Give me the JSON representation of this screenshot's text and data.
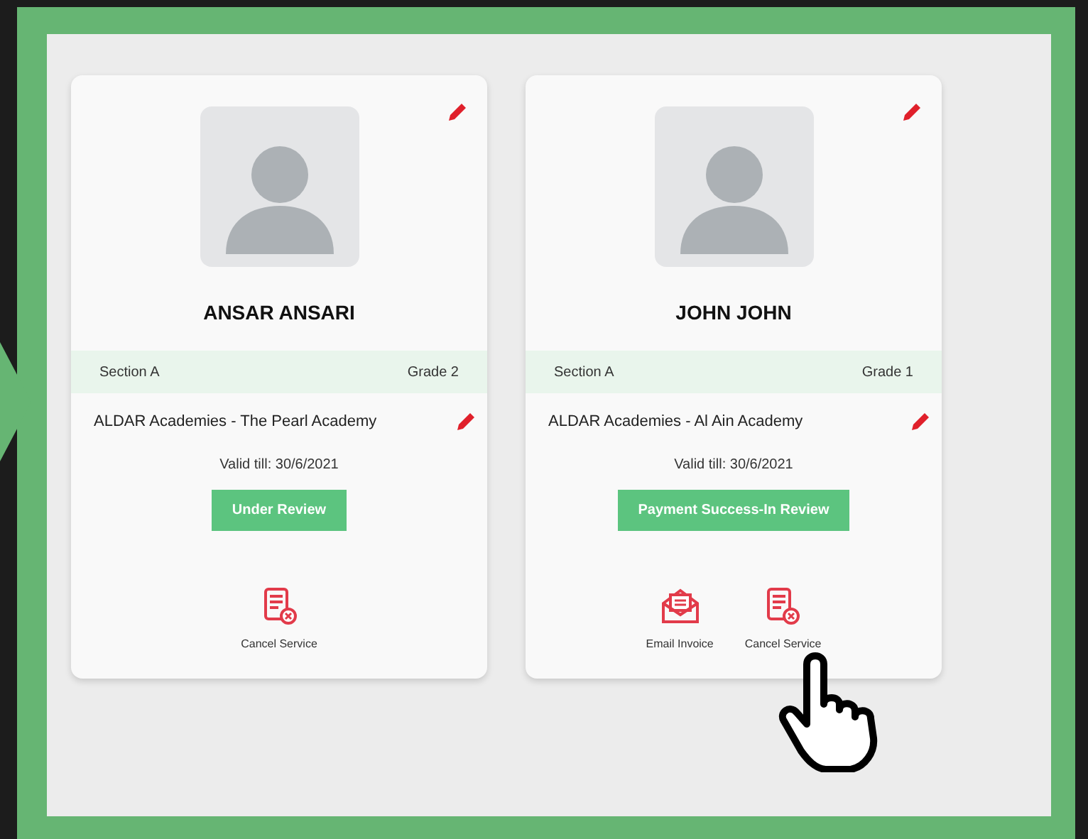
{
  "cards": [
    {
      "name": "ANSAR ANSARI",
      "section": "Section A",
      "grade": "Grade 2",
      "school": "ALDAR Academies - The Pearl Academy",
      "valid": "Valid till: 30/6/2021",
      "status": "Under Review",
      "actions": [
        {
          "kind": "cancel",
          "label": "Cancel Service"
        }
      ]
    },
    {
      "name": "JOHN JOHN",
      "section": "Section A",
      "grade": "Grade 1",
      "school": "ALDAR Academies - Al Ain Academy",
      "valid": "Valid till: 30/6/2021",
      "status": "Payment Success-In Review",
      "actions": [
        {
          "kind": "email",
          "label": "Email Invoice"
        },
        {
          "kind": "cancel",
          "label": "Cancel Service"
        }
      ]
    }
  ]
}
